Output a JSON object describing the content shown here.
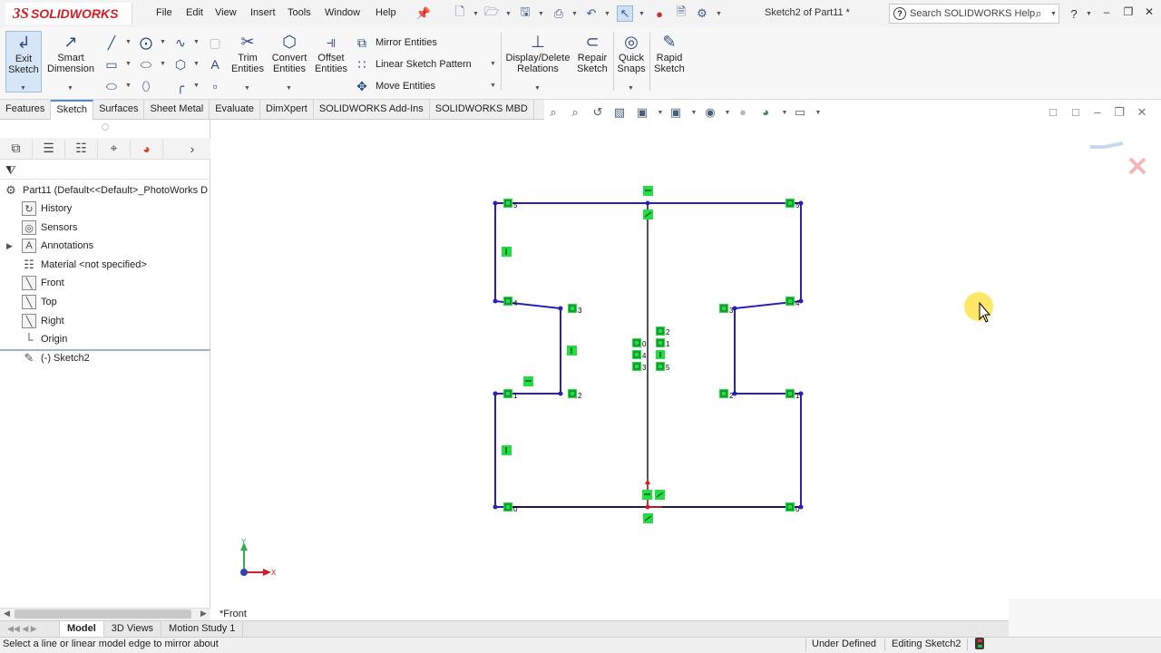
{
  "app": {
    "logo_prefix": "3S",
    "logo_name": "SOLIDWORKS",
    "window_title": "Sketch2 of Part11 *"
  },
  "menu": [
    "File",
    "Edit",
    "View",
    "Insert",
    "Tools",
    "Window",
    "Help"
  ],
  "search": {
    "placeholder": "Search SOLIDWORKS Help"
  },
  "toolbar": {
    "exit_sketch": "Exit Sketch",
    "smart_dimension": "Smart Dimension",
    "trim_entities": "Trim Entities",
    "convert_entities": "Convert Entities",
    "offset_entities": "Offset Entities",
    "mirror_entities": "Mirror Entities",
    "linear_sketch_pattern": "Linear Sketch Pattern",
    "move_entities": "Move Entities",
    "display_delete_relations": "Display/Delete Relations",
    "repair_sketch": "Repair Sketch",
    "quick_snaps": "Quick Snaps",
    "rapid_sketch": "Rapid Sketch"
  },
  "tabs": [
    "Features",
    "Sketch",
    "Surfaces",
    "Sheet Metal",
    "Evaluate",
    "DimXpert",
    "SOLIDWORKS Add-Ins",
    "SOLIDWORKS MBD"
  ],
  "active_tab": "Sketch",
  "tree": {
    "root": "Part11  (Default<<Default>_PhotoWorks D",
    "items": [
      {
        "label": "History",
        "icon": "history-icon"
      },
      {
        "label": "Sensors",
        "icon": "sensors-icon"
      },
      {
        "label": "Annotations",
        "icon": "annotations-icon"
      },
      {
        "label": "Material <not specified>",
        "icon": "material-icon"
      },
      {
        "label": "Front",
        "icon": "plane-icon"
      },
      {
        "label": "Top",
        "icon": "plane-icon"
      },
      {
        "label": "Right",
        "icon": "plane-icon"
      },
      {
        "label": "Origin",
        "icon": "origin-icon"
      },
      {
        "label": "(-) Sketch2",
        "icon": "sketch-icon"
      }
    ]
  },
  "viewport": {
    "view_name": "*Front",
    "triad_y": "Y",
    "triad_x": "X"
  },
  "sketch_labels": {
    "n5": "5",
    "n4": "4",
    "n3": "3",
    "n2": "2",
    "n1": "1",
    "n0": "0"
  },
  "bottom_tabs": [
    "Model",
    "3D Views",
    "Motion Study 1"
  ],
  "active_bottom_tab": "Model",
  "status": {
    "message": "Select a line or linear model edge to mirror about",
    "sketch_state": "Under Defined",
    "editing": "Editing Sketch2"
  },
  "colors": {
    "sketch_line": "#2a20b8",
    "centerline": "#1a1a1a",
    "relation_green": "#22dd44",
    "accent_red": "#d22027",
    "cursor_highlight": "#ffe34d"
  }
}
